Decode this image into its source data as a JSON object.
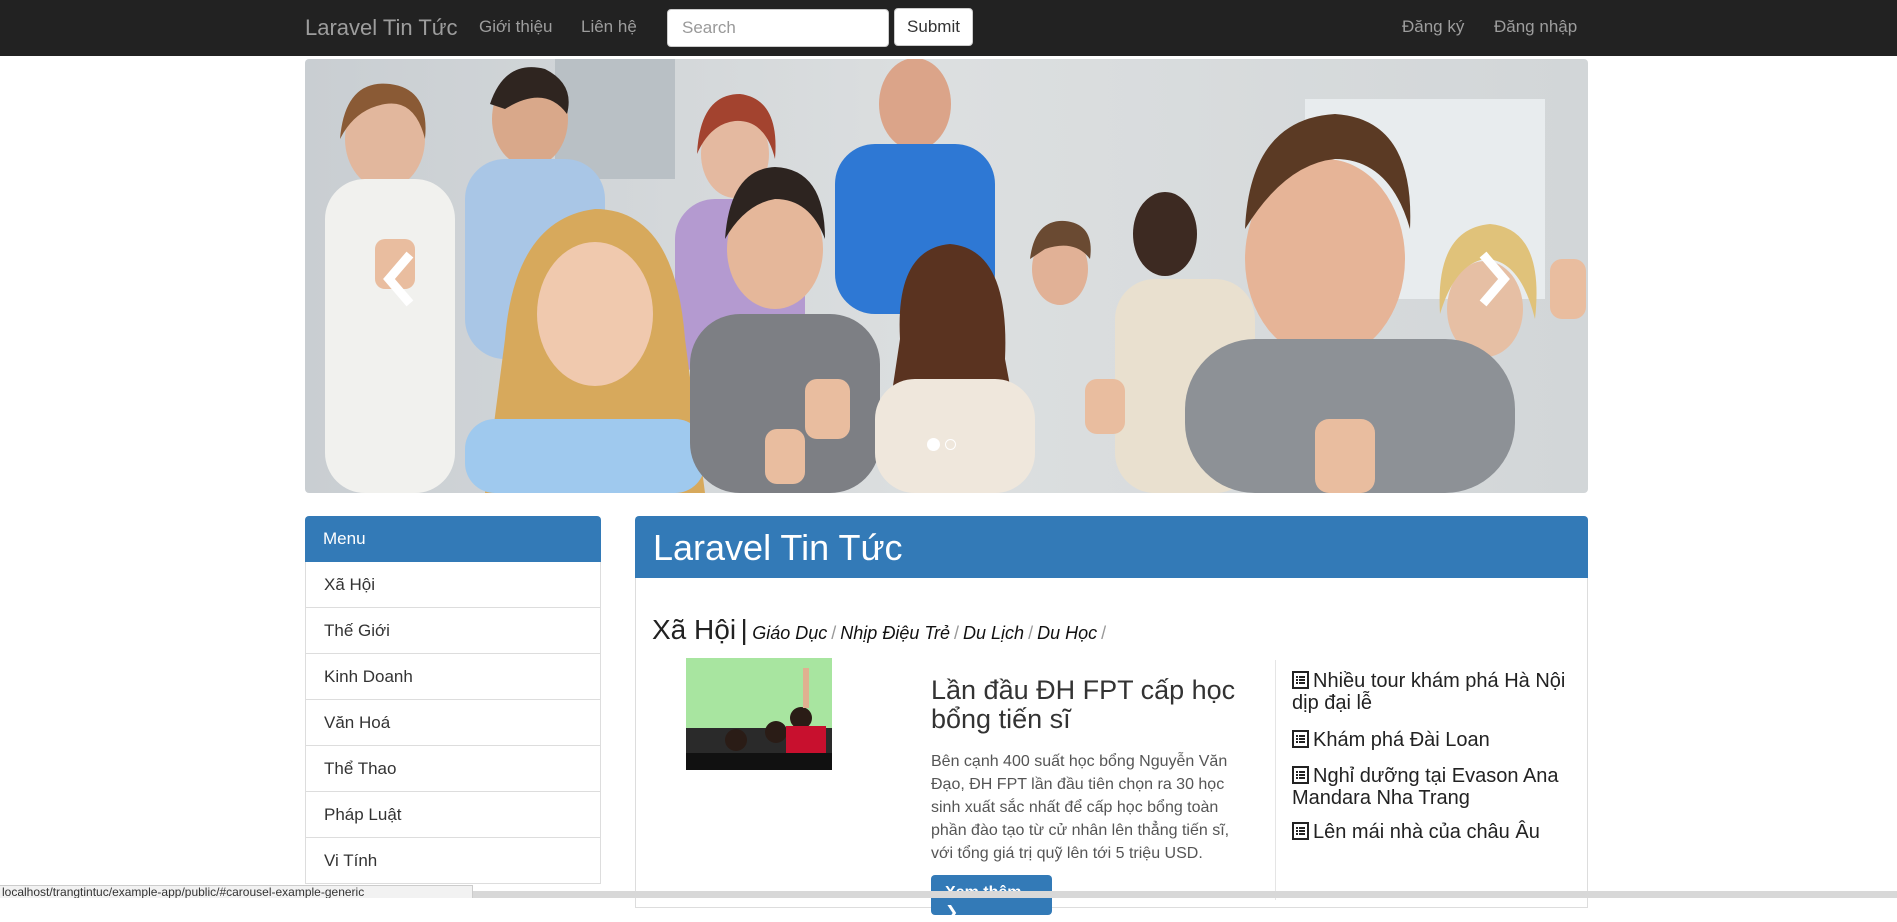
{
  "navbar": {
    "brand": "Laravel Tin Tức",
    "links": [
      "Giới thiệu",
      "Liên hệ"
    ],
    "search_placeholder": "Search",
    "submit_label": "Submit",
    "register_label": "Đăng ký",
    "login_label": "Đăng nhập",
    "background": "#222222"
  },
  "carousel": {
    "slide_count": 2,
    "active_slide": 1,
    "prev_icon": "chevron-left-icon",
    "next_icon": "chevron-right-icon"
  },
  "menu": {
    "title": "Menu",
    "items": [
      "Xã Hội",
      "Thế Giới",
      "Kinh Doanh",
      "Văn Hoá",
      "Thể Thao",
      "Pháp Luật",
      "Vi Tính"
    ]
  },
  "main": {
    "panel_title": "Laravel Tin Tức",
    "category": "Xã Hội",
    "category_separator": "|",
    "subcategories": [
      "Giáo Dục",
      "Nhịp Điệu Trẻ",
      "Du Lịch",
      "Du Học"
    ],
    "subcategory_separator": "/",
    "featured": {
      "title": "Lần đầu ĐH FPT cấp học bổng tiến sĩ",
      "summary": "Bên cạnh 400 suất học bổng Nguyễn Văn Đạo, ĐH FPT lần đầu tiên chọn ra 30 học sinh xuất sắc nhất để cấp học bổng toàn phần đào tạo từ cử nhân lên thẳng tiến sĩ, với tổng giá trị quỹ lên tới 5 triệu USD.",
      "more_label": "Xem thêm"
    },
    "related": [
      "Nhiều tour khám phá Hà Nội dịp đại lễ",
      "Khám phá Đài Loan",
      "Nghỉ dưỡng tại Evason Ana Mandara Nha Trang",
      "Lên mái nhà của châu Âu"
    ]
  },
  "statusbar": {
    "url": "localhost/trangtintuc/example-app/public/#carousel-example-generic"
  },
  "colors": {
    "primary": "#337ab7",
    "navbar": "#222222",
    "nav_text": "#9d9d9d"
  }
}
